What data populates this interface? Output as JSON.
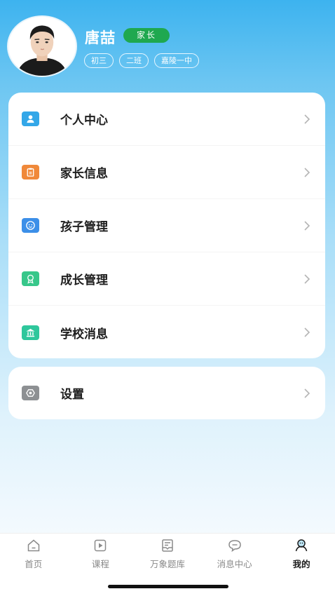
{
  "profile": {
    "name": "唐喆",
    "role": "家长",
    "tags": [
      "初三",
      "二班",
      "嘉陵一中"
    ]
  },
  "menu": {
    "items": [
      {
        "label": "个人中心",
        "icon": "user-icon",
        "color": "#33a7e8"
      },
      {
        "label": "家长信息",
        "icon": "clipboard-icon",
        "color": "#f0893a"
      },
      {
        "label": "孩子管理",
        "icon": "face-icon",
        "color": "#3c8fe8"
      },
      {
        "label": "成长管理",
        "icon": "medal-icon",
        "color": "#37c78a"
      },
      {
        "label": "学校消息",
        "icon": "school-icon",
        "color": "#2fc79c"
      }
    ],
    "settings": {
      "label": "设置",
      "icon": "gear-icon",
      "color": "#8d9093"
    }
  },
  "tabbar": {
    "tabs": [
      {
        "label": "首页",
        "icon": "home-icon"
      },
      {
        "label": "课程",
        "icon": "play-icon"
      },
      {
        "label": "万象题库",
        "icon": "question-bank-icon"
      },
      {
        "label": "消息中心",
        "icon": "chat-icon"
      },
      {
        "label": "我的",
        "icon": "profile-icon",
        "active": true
      }
    ]
  }
}
